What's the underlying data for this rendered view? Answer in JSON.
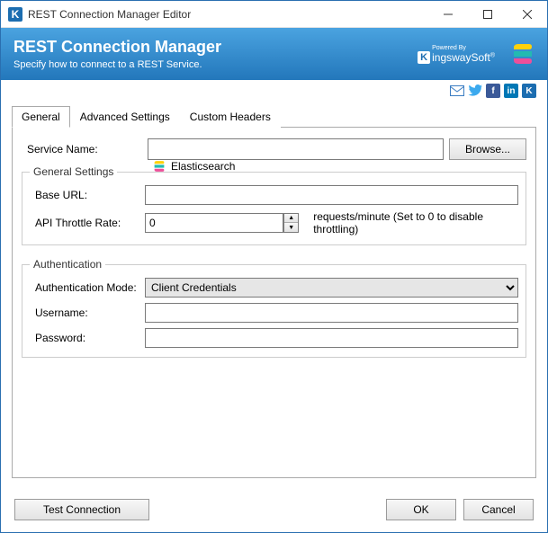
{
  "window": {
    "title": "REST Connection Manager Editor"
  },
  "banner": {
    "heading": "REST Connection Manager",
    "sub": "Specify how to connect to a REST Service."
  },
  "brand": {
    "powered": "Powered By",
    "name": "ingswaySoft"
  },
  "tabs": {
    "general": "General",
    "advanced": "Advanced Settings",
    "custom": "Custom Headers"
  },
  "labels": {
    "serviceName": "Service Name:",
    "browse": "Browse...",
    "generalSettings": "General Settings",
    "baseUrl": "Base URL:",
    "apiThrottle": "API Throttle Rate:",
    "throttleHint": "requests/minute (Set to 0 to disable throttling)",
    "authentication": "Authentication",
    "authMode": "Authentication Mode:",
    "username": "Username:",
    "password": "Password:"
  },
  "values": {
    "service": "Elasticsearch",
    "baseUrl": "",
    "throttle": "0",
    "authMode": "Client Credentials",
    "username": "",
    "password": ""
  },
  "footer": {
    "test": "Test Connection",
    "ok": "OK",
    "cancel": "Cancel"
  }
}
